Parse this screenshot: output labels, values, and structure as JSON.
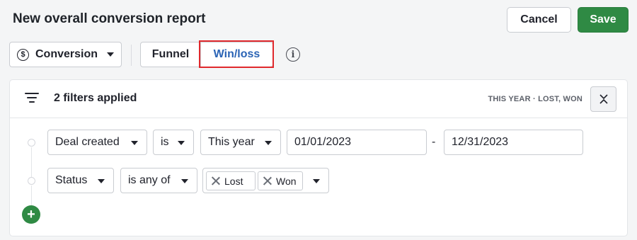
{
  "header": {
    "title": "New overall conversion report",
    "cancel_label": "Cancel",
    "save_label": "Save"
  },
  "toolbar": {
    "report_type": "Conversion",
    "views": [
      "Funnel",
      "Win/loss"
    ],
    "active_view": "Win/loss",
    "info_icon": "info-icon"
  },
  "filters": {
    "applied_label": "2 filters applied",
    "summary": "THIS YEAR · LOST, WON",
    "rows": [
      {
        "field": "Deal created",
        "operator": "is",
        "value": "This year",
        "from": "01/01/2023",
        "separator": "-",
        "to": "12/31/2023"
      },
      {
        "field": "Status",
        "operator": "is any of",
        "tags": [
          "Lost",
          "Won"
        ]
      }
    ],
    "add_label": "+"
  },
  "colors": {
    "accent_green": "#2f8a44",
    "active_blue": "#2b64b5",
    "highlight_red": "#e0282c"
  }
}
